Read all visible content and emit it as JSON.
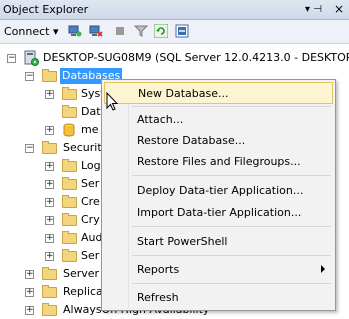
{
  "window": {
    "title": "Object Explorer",
    "pin_glyph": "▾ ⊣",
    "close_glyph": "×"
  },
  "toolbar": {
    "connect_label": "Connect ▾",
    "icons": [
      "connect-object-explorer-icon",
      "disconnect-icon",
      "stop-icon",
      "filter-icon",
      "refresh-icon",
      "collapse-icon"
    ]
  },
  "tree": {
    "server_label": "DESKTOP-SUG08M9 (SQL Server 12.0.4213.0 - DESKTOP-S",
    "databases_label": "Databases",
    "db_children": [
      "Syst",
      "Dat",
      "me"
    ],
    "security_label": "Security",
    "security_children": [
      "Log",
      "Ser",
      "Cre",
      "Cry",
      "Aud",
      "Ser"
    ],
    "server_objects_label": "Server O",
    "replication_label": "Replica",
    "alwayson_label": "AlwaysOn High Availability"
  },
  "context_menu": {
    "items": [
      {
        "label": "New Database...",
        "hover": true
      },
      {
        "label": "Attach..."
      },
      {
        "label": "Restore Database..."
      },
      {
        "label": "Restore Files and Filegroups..."
      },
      {
        "label": "Deploy Data-tier Application..."
      },
      {
        "label": "Import Data-tier Application..."
      },
      {
        "label": "Start PowerShell"
      },
      {
        "label": "Reports",
        "submenu": true
      },
      {
        "label": "Refresh"
      }
    ]
  }
}
